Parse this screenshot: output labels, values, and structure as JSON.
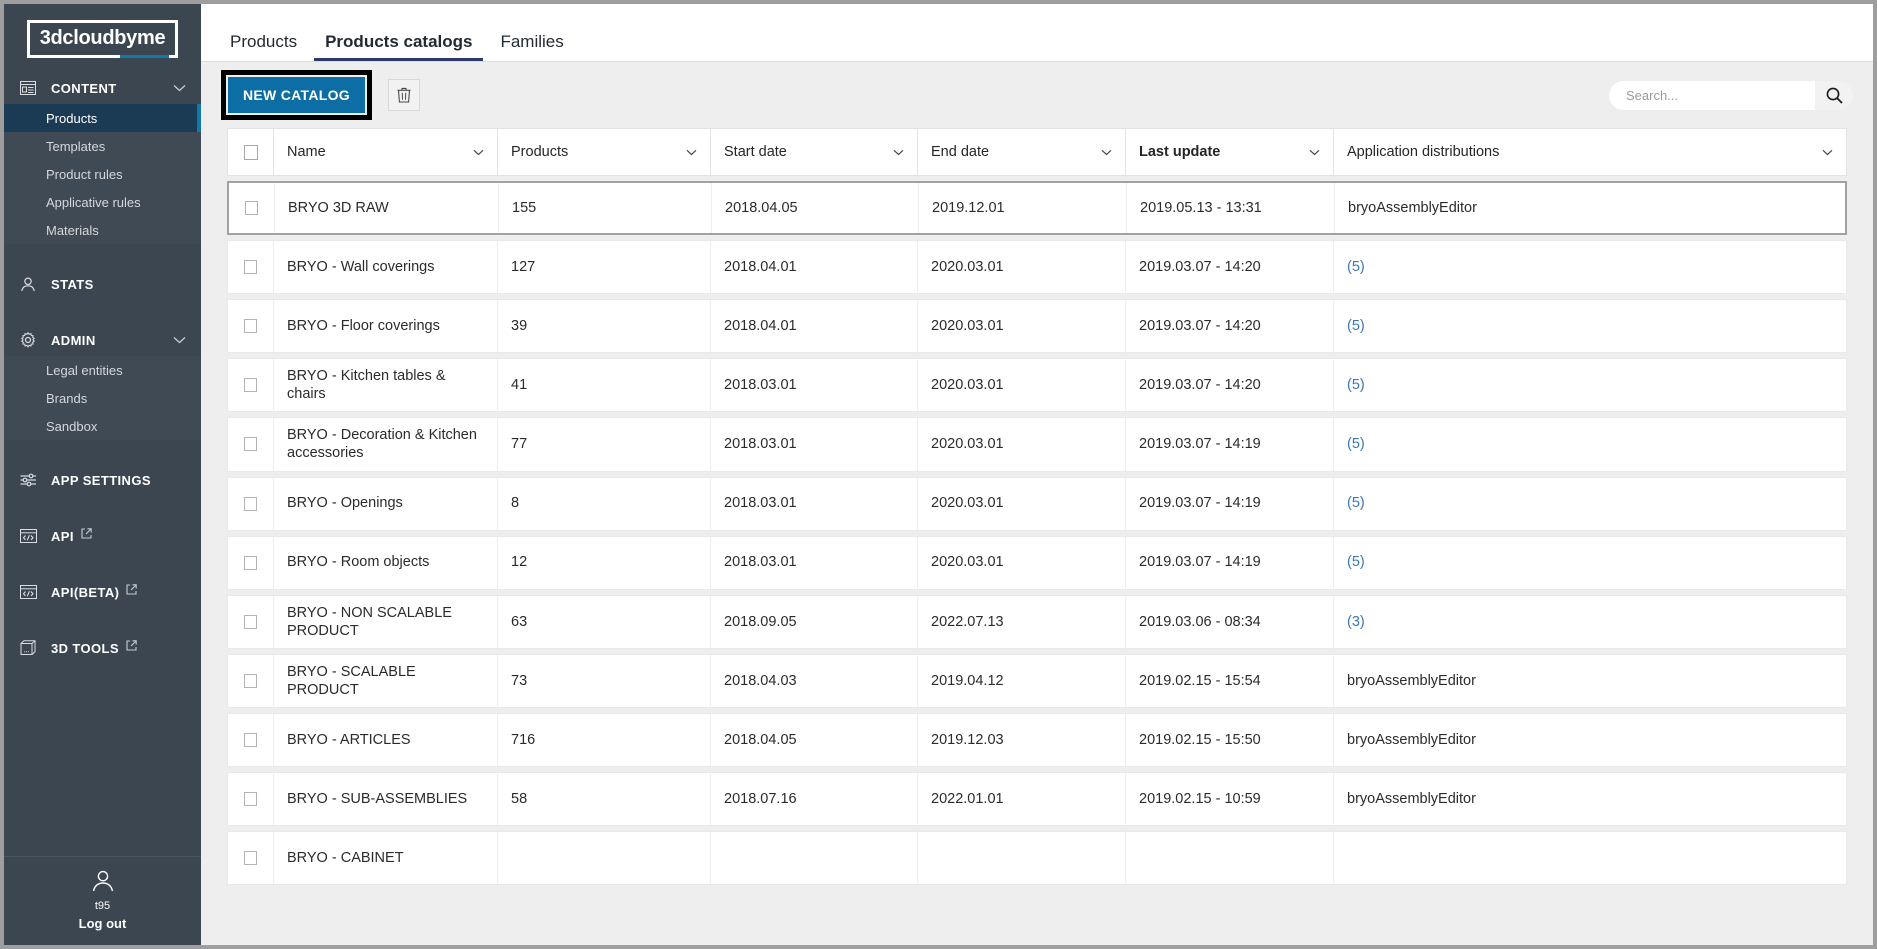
{
  "brand": {
    "name": "3dcloudbyme"
  },
  "sidebar": {
    "groups": [
      {
        "label": "CONTENT",
        "icon": "content-icon",
        "chevron": "chevron-down-icon",
        "items": [
          {
            "label": "Products",
            "active": true
          },
          {
            "label": "Templates",
            "active": false
          },
          {
            "label": "Product rules",
            "active": false
          },
          {
            "label": "Applicative rules",
            "active": false
          },
          {
            "label": "Materials",
            "active": false
          }
        ]
      },
      {
        "label": "STATS",
        "icon": "person-icon",
        "items": []
      },
      {
        "label": "ADMIN",
        "icon": "gear-icon",
        "chevron": "chevron-down-icon",
        "items": [
          {
            "label": "Legal entities",
            "active": false
          },
          {
            "label": "Brands",
            "active": false
          },
          {
            "label": "Sandbox",
            "active": false
          }
        ]
      },
      {
        "label": "APP SETTINGS",
        "icon": "sliders-icon",
        "items": []
      },
      {
        "label": "API",
        "icon": "code-window-icon",
        "external": true,
        "items": []
      },
      {
        "label": "API(BETA)",
        "icon": "code-window-icon",
        "external": true,
        "items": []
      },
      {
        "label": "3D TOOLS",
        "icon": "cube-icon",
        "external": true,
        "items": []
      }
    ],
    "footer": {
      "avatar_icon": "user-avatar-icon",
      "user": "t95",
      "logout": "Log out"
    }
  },
  "tabs": [
    {
      "label": "Products",
      "active": false
    },
    {
      "label": "Products catalogs",
      "active": true
    },
    {
      "label": "Families",
      "active": false
    }
  ],
  "toolbar": {
    "new_catalog_label": "NEW CATALOG",
    "delete_icon": "trash-icon",
    "highlighted": true
  },
  "search": {
    "placeholder": "Search...",
    "value": "",
    "icon": "search-icon"
  },
  "colors": {
    "primary_button": "#0d6ea5",
    "sidebar_bg": "#3b4650",
    "active_item_bg": "#1b3a53",
    "accent": "#1278a8",
    "tab_underline": "#2b3a66",
    "link": "#3c78b4",
    "highlight_box": "#000000"
  },
  "table": {
    "columns": [
      {
        "key": "checkbox",
        "label": "",
        "sorted": false
      },
      {
        "key": "name",
        "label": "Name",
        "sorted": false
      },
      {
        "key": "products",
        "label": "Products",
        "sorted": false
      },
      {
        "key": "start_date",
        "label": "Start date",
        "sorted": false
      },
      {
        "key": "end_date",
        "label": "End date",
        "sorted": false
      },
      {
        "key": "last_update",
        "label": "Last update",
        "sorted": true
      },
      {
        "key": "application_distributions",
        "label": "Application distributions",
        "sorted": false
      }
    ],
    "rows": [
      {
        "name": "BRYO 3D RAW",
        "products": "155",
        "start_date": "2018.04.05",
        "end_date": "2019.12.01",
        "last_update": "2019.05.13 - 13:31",
        "apps": "bryoAssemblyEditor",
        "apps_is_link": false,
        "highlight": true
      },
      {
        "name": "BRYO - Wall coverings",
        "products": "127",
        "start_date": "2018.04.01",
        "end_date": "2020.03.01",
        "last_update": "2019.03.07 - 14:20",
        "apps": "(5)",
        "apps_is_link": true,
        "highlight": false
      },
      {
        "name": "BRYO - Floor coverings",
        "products": "39",
        "start_date": "2018.04.01",
        "end_date": "2020.03.01",
        "last_update": "2019.03.07 - 14:20",
        "apps": "(5)",
        "apps_is_link": true,
        "highlight": false
      },
      {
        "name": "BRYO - Kitchen tables & chairs",
        "products": "41",
        "start_date": "2018.03.01",
        "end_date": "2020.03.01",
        "last_update": "2019.03.07 - 14:20",
        "apps": "(5)",
        "apps_is_link": true,
        "highlight": false
      },
      {
        "name": "BRYO - Decoration & Kitchen accessories",
        "products": "77",
        "start_date": "2018.03.01",
        "end_date": "2020.03.01",
        "last_update": "2019.03.07 - 14:19",
        "apps": "(5)",
        "apps_is_link": true,
        "highlight": false
      },
      {
        "name": "BRYO - Openings",
        "products": "8",
        "start_date": "2018.03.01",
        "end_date": "2020.03.01",
        "last_update": "2019.03.07 - 14:19",
        "apps": "(5)",
        "apps_is_link": true,
        "highlight": false
      },
      {
        "name": "BRYO - Room objects",
        "products": "12",
        "start_date": "2018.03.01",
        "end_date": "2020.03.01",
        "last_update": "2019.03.07 - 14:19",
        "apps": "(5)",
        "apps_is_link": true,
        "highlight": false
      },
      {
        "name": "BRYO - NON SCALABLE PRODUCT",
        "products": "63",
        "start_date": "2018.09.05",
        "end_date": "2022.07.13",
        "last_update": "2019.03.06 - 08:34",
        "apps": "(3)",
        "apps_is_link": true,
        "highlight": false
      },
      {
        "name": "BRYO - SCALABLE PRODUCT",
        "products": "73",
        "start_date": "2018.04.03",
        "end_date": "2019.04.12",
        "last_update": "2019.02.15 - 15:54",
        "apps": "bryoAssemblyEditor",
        "apps_is_link": false,
        "highlight": false
      },
      {
        "name": "BRYO - ARTICLES",
        "products": "716",
        "start_date": "2018.04.05",
        "end_date": "2019.12.03",
        "last_update": "2019.02.15 - 15:50",
        "apps": "bryoAssemblyEditor",
        "apps_is_link": false,
        "highlight": false
      },
      {
        "name": "BRYO - SUB-ASSEMBLIES",
        "products": "58",
        "start_date": "2018.07.16",
        "end_date": "2022.01.01",
        "last_update": "2019.02.15 - 10:59",
        "apps": "bryoAssemblyEditor",
        "apps_is_link": false,
        "highlight": false
      },
      {
        "name": "BRYO - CABINET",
        "products": "",
        "start_date": "",
        "end_date": "",
        "last_update": "",
        "apps": "",
        "apps_is_link": false,
        "highlight": false
      }
    ]
  }
}
